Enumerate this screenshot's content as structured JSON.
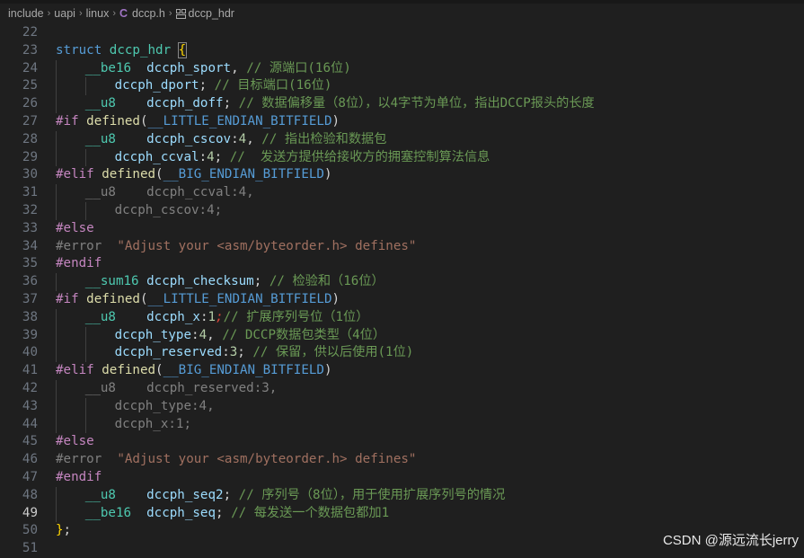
{
  "breadcrumb": {
    "parts": [
      "include",
      "uapi",
      "linux",
      "dccp.h",
      "dccp_hdr"
    ],
    "file_icon": "C"
  },
  "lines": [
    {
      "n": "22",
      "t": []
    },
    {
      "n": "23",
      "t": [
        [
          "kw",
          "struct "
        ],
        [
          "type",
          "dccp_hdr "
        ],
        [
          "bracket",
          "{"
        ]
      ]
    },
    {
      "n": "24",
      "i": 1,
      "t": [
        [
          "type",
          "__be16"
        ],
        [
          "",
          "  "
        ],
        [
          "fld",
          "dccph_sport"
        ],
        [
          "",
          ", "
        ],
        [
          "cm",
          "// 源端口(16位)"
        ]
      ]
    },
    {
      "n": "25",
      "i": 2,
      "t": [
        [
          "fld",
          "dccph_dport"
        ],
        [
          "",
          "; "
        ],
        [
          "cm",
          "// 目标端口(16位)"
        ]
      ]
    },
    {
      "n": "26",
      "i": 1,
      "t": [
        [
          "type",
          "__u8"
        ],
        [
          "",
          "    "
        ],
        [
          "fld",
          "dccph_doff"
        ],
        [
          "",
          "; "
        ],
        [
          "cm",
          "// 数据偏移量（8位），以4字节为单位，指出DCCP报头的长度"
        ]
      ]
    },
    {
      "n": "27",
      "t": [
        [
          "pp",
          "#if "
        ],
        [
          "fn",
          "defined"
        ],
        [
          "",
          "("
        ],
        [
          "mac",
          "__LITTLE_ENDIAN_BITFIELD"
        ],
        [
          "",
          ")"
        ]
      ]
    },
    {
      "n": "28",
      "i": 1,
      "t": [
        [
          "type",
          "__u8"
        ],
        [
          "",
          "    "
        ],
        [
          "fld",
          "dccph_cscov"
        ],
        [
          "",
          ":"
        ],
        [
          "num",
          "4"
        ],
        [
          "",
          ", "
        ],
        [
          "cm",
          "// 指出检验和数据包"
        ]
      ]
    },
    {
      "n": "29",
      "i": 2,
      "t": [
        [
          "fld",
          "dccph_ccval"
        ],
        [
          "",
          ":"
        ],
        [
          "num",
          "4"
        ],
        [
          "",
          "; "
        ],
        [
          "cm",
          "//  发送方提供给接收方的拥塞控制算法信息"
        ]
      ]
    },
    {
      "n": "30",
      "t": [
        [
          "pp",
          "#elif "
        ],
        [
          "fn",
          "defined"
        ],
        [
          "",
          "("
        ],
        [
          "mac",
          "__BIG_ENDIAN_BITFIELD"
        ],
        [
          "",
          ")"
        ]
      ]
    },
    {
      "n": "31",
      "i": 1,
      "t": [
        [
          "dim",
          "__u8    dccph_ccval:4,"
        ]
      ]
    },
    {
      "n": "32",
      "i": 2,
      "t": [
        [
          "dim",
          "dccph_cscov:4;"
        ]
      ]
    },
    {
      "n": "33",
      "t": [
        [
          "pp",
          "#else"
        ]
      ]
    },
    {
      "n": "34",
      "t": [
        [
          "dim",
          "#error  "
        ],
        [
          "dimstr",
          "\"Adjust your <asm/byteorder.h> defines\""
        ]
      ]
    },
    {
      "n": "35",
      "t": [
        [
          "pp",
          "#endif"
        ]
      ]
    },
    {
      "n": "36",
      "i": 1,
      "t": [
        [
          "type",
          "__sum16"
        ],
        [
          "",
          " "
        ],
        [
          "fld",
          "dccph_checksum"
        ],
        [
          "",
          "; "
        ],
        [
          "cm",
          "// 检验和（16位）"
        ]
      ]
    },
    {
      "n": "37",
      "t": [
        [
          "pp",
          "#if "
        ],
        [
          "fn",
          "defined"
        ],
        [
          "",
          "("
        ],
        [
          "mac",
          "__LITTLE_ENDIAN_BITFIELD"
        ],
        [
          "",
          ")"
        ]
      ]
    },
    {
      "n": "38",
      "i": 1,
      "t": [
        [
          "type",
          "__u8"
        ],
        [
          "",
          "    "
        ],
        [
          "fld",
          "dccph_x"
        ],
        [
          "",
          ":"
        ],
        [
          "num",
          "1"
        ],
        [
          "pen",
          ";"
        ],
        [
          "cm",
          "// 扩展序列号位（1位）"
        ]
      ]
    },
    {
      "n": "39",
      "i": 2,
      "t": [
        [
          "fld",
          "dccph_type"
        ],
        [
          "",
          ":"
        ],
        [
          "num",
          "4"
        ],
        [
          "",
          ", "
        ],
        [
          "cm",
          "// DCCP数据包类型（4位）"
        ]
      ]
    },
    {
      "n": "40",
      "i": 2,
      "t": [
        [
          "fld",
          "dccph_reserved"
        ],
        [
          "",
          ":"
        ],
        [
          "num",
          "3"
        ],
        [
          "",
          "; "
        ],
        [
          "cm",
          "// 保留，供以后使用(1位)"
        ]
      ]
    },
    {
      "n": "41",
      "t": [
        [
          "pp",
          "#elif "
        ],
        [
          "fn",
          "defined"
        ],
        [
          "",
          "("
        ],
        [
          "mac",
          "__BIG_ENDIAN_BITFIELD"
        ],
        [
          "",
          ")"
        ]
      ]
    },
    {
      "n": "42",
      "i": 1,
      "t": [
        [
          "dim",
          "__u8    dccph_reserved:3,"
        ]
      ]
    },
    {
      "n": "43",
      "i": 2,
      "t": [
        [
          "dim",
          "dccph_type:4,"
        ]
      ]
    },
    {
      "n": "44",
      "i": 2,
      "t": [
        [
          "dim",
          "dccph_x:1;"
        ]
      ]
    },
    {
      "n": "45",
      "t": [
        [
          "pp",
          "#else"
        ]
      ]
    },
    {
      "n": "46",
      "t": [
        [
          "dim",
          "#error  "
        ],
        [
          "dimstr",
          "\"Adjust your <asm/byteorder.h> defines\""
        ]
      ]
    },
    {
      "n": "47",
      "t": [
        [
          "pp",
          "#endif"
        ]
      ]
    },
    {
      "n": "48",
      "i": 1,
      "t": [
        [
          "type",
          "__u8"
        ],
        [
          "",
          "    "
        ],
        [
          "fld",
          "dccph_seq2"
        ],
        [
          "",
          "; "
        ],
        [
          "cm",
          "// 序列号（8位），用于使用扩展序列号的情况"
        ]
      ]
    },
    {
      "n": "49",
      "i": 1,
      "cur": true,
      "t": [
        [
          "type",
          "__be16"
        ],
        [
          "",
          "  "
        ],
        [
          "fld",
          "dccph_seq"
        ],
        [
          "",
          "; "
        ],
        [
          "cm",
          "// 每发送一个数据包都加1"
        ]
      ]
    },
    {
      "n": "50",
      "t": [
        [
          "bracket",
          "}"
        ],
        [
          "",
          ";"
        ]
      ]
    },
    {
      "n": "51",
      "t": []
    }
  ],
  "watermark": "CSDN @源远流长jerry"
}
